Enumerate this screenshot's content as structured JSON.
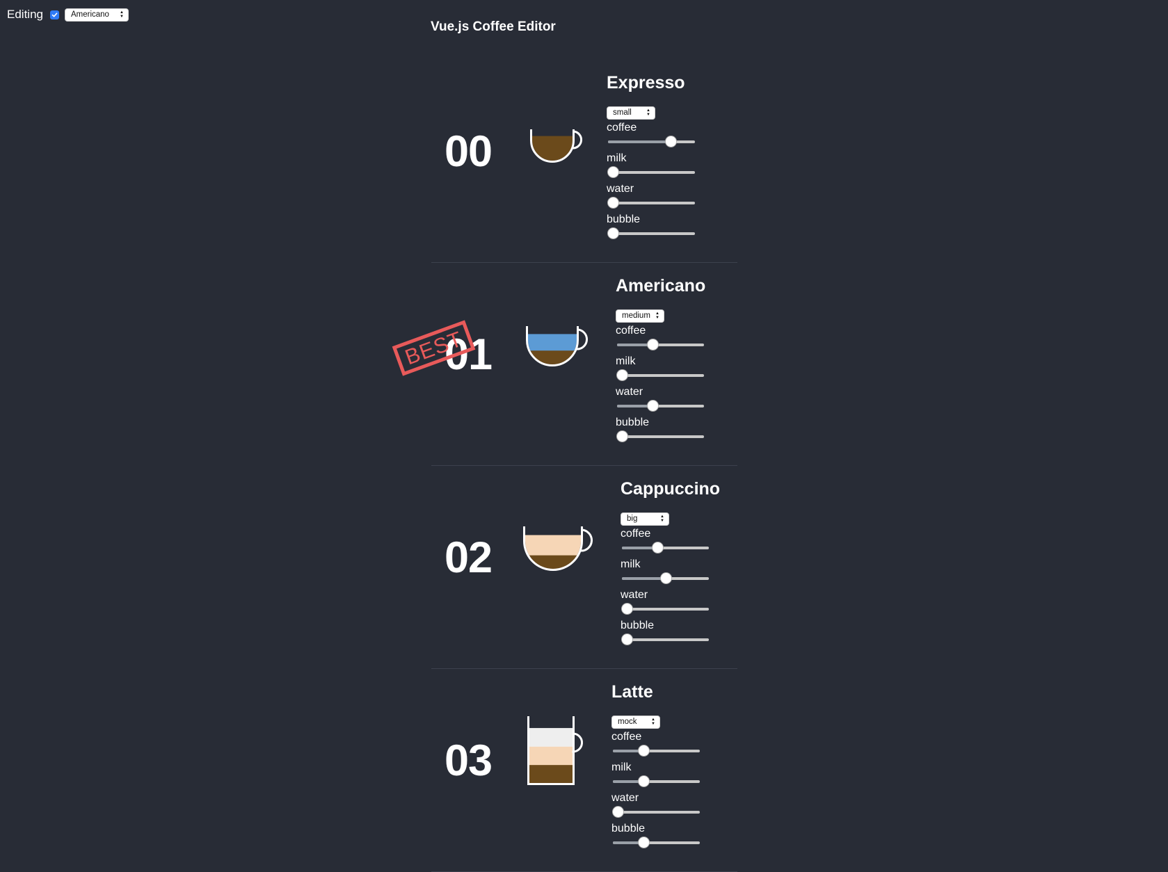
{
  "topbar": {
    "editing_label": "Editing",
    "editing_checked": true,
    "selected_coffee": "Americano"
  },
  "app": {
    "title": "Vue.js Coffee Editor"
  },
  "coffees": [
    {
      "index": "00",
      "name": "Expresso",
      "size": "small",
      "cup_style": "round",
      "ingredients": {
        "coffee": 0.75,
        "milk": 0.0,
        "water": 0.0,
        "bubble": 0.0
      }
    },
    {
      "index": "01",
      "name": "Americano",
      "size": "medium",
      "cup_style": "round",
      "stamp": "BEST",
      "ingredients": {
        "coffee": 0.4,
        "milk": 0.0,
        "water": 0.4,
        "bubble": 0.0
      }
    },
    {
      "index": "02",
      "name": "Cappuccino",
      "size": "big",
      "cup_style": "round",
      "ingredients": {
        "coffee": 0.4,
        "milk": 0.5,
        "water": 0.0,
        "bubble": 0.0
      }
    },
    {
      "index": "03",
      "name": "Latte",
      "size": "mock",
      "cup_style": "mug",
      "ingredients": {
        "coffee": 0.33,
        "milk": 0.33,
        "water": 0.0,
        "bubble": 0.33
      }
    }
  ],
  "ingredient_labels": [
    "coffee",
    "milk",
    "water",
    "bubble"
  ],
  "colors": {
    "background": "#282c36",
    "coffee": "#6b4a1b",
    "water": "#5c9bd5",
    "milk": "#f6d6b6",
    "bubble": "#eeeeee",
    "stamp": "#e85a5a",
    "accent": "#2f7bf6"
  }
}
